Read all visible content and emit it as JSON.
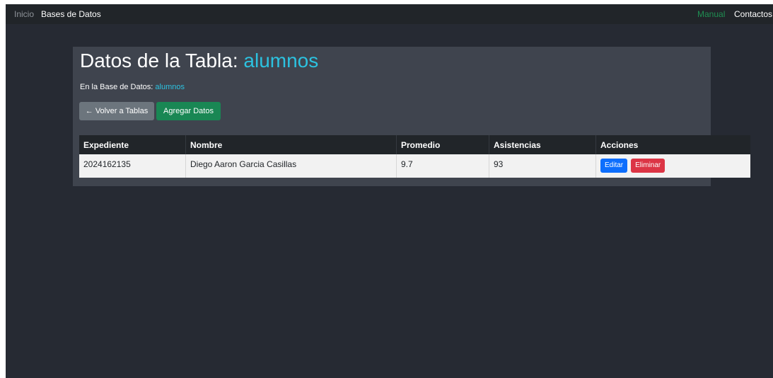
{
  "nav": {
    "inicio": "Inicio",
    "bases": "Bases de Datos",
    "manual": "Manual",
    "contactos": "Contactos"
  },
  "page": {
    "title_prefix": "Datos de la Tabla:",
    "table_name": "alumnos",
    "db_label": "En la Base de Datos:",
    "db_name": "alumnos"
  },
  "buttons": {
    "back": "← Volver a Tablas",
    "add": "Agregar Datos"
  },
  "table": {
    "headers": [
      "Expediente",
      "Nombre",
      "Promedio",
      "Asistencias",
      "Acciones"
    ],
    "rows": [
      {
        "expediente": "2024162135",
        "nombre": "Diego Aaron Garcia Casillas",
        "promedio": "9.7",
        "asistencias": "93"
      }
    ],
    "edit_label": "Editar",
    "delete_label": "Eliminar"
  },
  "colors": {
    "background": "#262a33",
    "navbar": "#212529",
    "panel": "#3f444e",
    "accent": "#2cc2e0",
    "back_button": "#6c757d",
    "add_button": "#198754",
    "edit_button": "#0d6efd",
    "delete_button": "#dc3545",
    "manual_link": "#1f8f52"
  }
}
